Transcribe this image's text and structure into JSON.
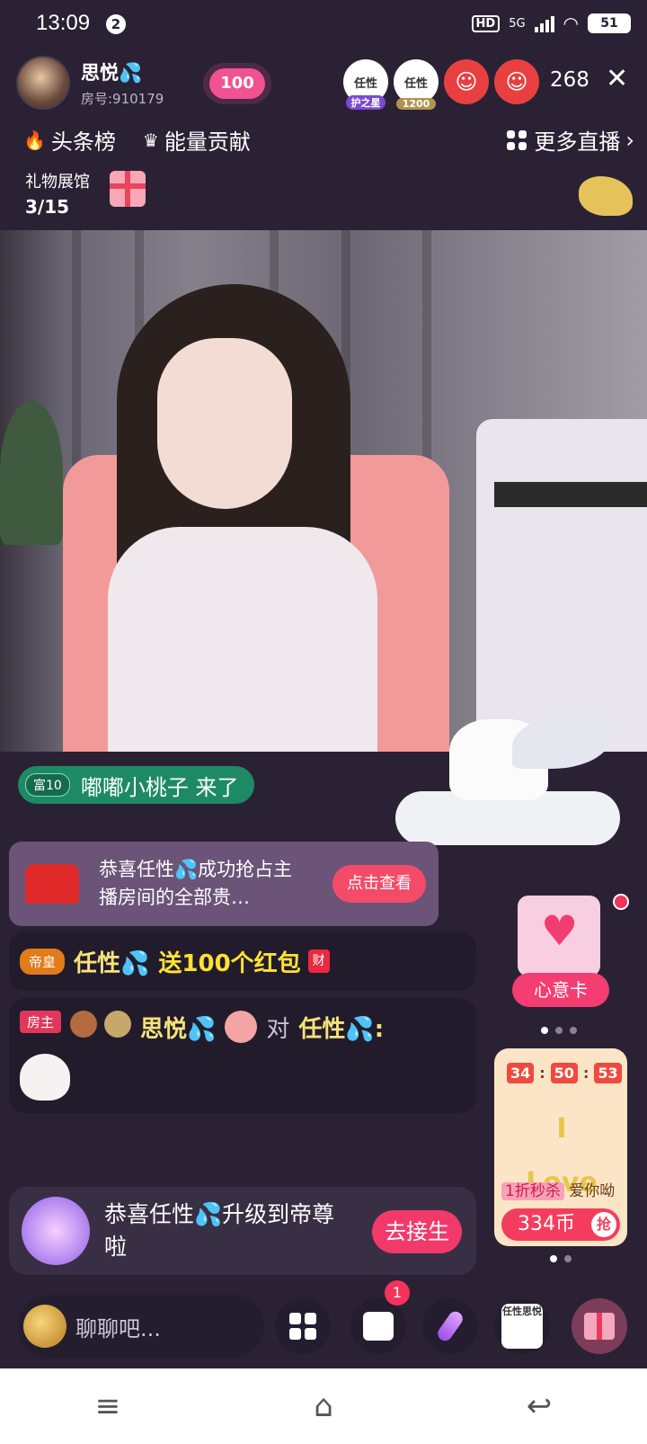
{
  "status_bar": {
    "time": "13:09",
    "notif_count": "2",
    "hd": "HD",
    "network": "5G",
    "battery": "51"
  },
  "header": {
    "host_name": "思悦💦",
    "room_number": "房号:910179",
    "heart_value": "100",
    "viewers": [
      {
        "label": "任性",
        "tag": "护之星"
      },
      {
        "label": "任性",
        "tag": "1200"
      }
    ],
    "viewer_count": "268",
    "tabs": [
      {
        "label": "头条榜",
        "icon": "flame-icon"
      },
      {
        "label": "能量贡献",
        "icon": "crown-icon"
      }
    ],
    "more_live": "更多直播",
    "gift_hall": {
      "title": "礼物展馆",
      "count": "3/15"
    }
  },
  "chat": {
    "enter_badge": "富10",
    "enter_text": "嘟嘟小桃子 来了",
    "card_text": "恭喜任性💦成功抢占主播房间的全部贵…",
    "card_button": "点击查看",
    "redpack_badge": "帝皇",
    "redpack_user": "任性💦",
    "redpack_text": "送100个红包",
    "redpack_icon_text": "财",
    "host_tag": "房主",
    "host_name": "思悦💦",
    "to_word": "对",
    "target": "任性💦:",
    "upgrade_text": "恭喜任性💦升级到帝尊啦",
    "upgrade_button": "去接生"
  },
  "wish_card": {
    "label": "心意卡"
  },
  "promo": {
    "timer": [
      "34",
      "50",
      "53"
    ],
    "love_text": "I Love",
    "sale": "1折秒杀",
    "deal_text": "爱你呦",
    "price": "334币",
    "grab": "抢"
  },
  "bottom": {
    "placeholder": "聊聊吧...",
    "message_badge": "1",
    "avatar_text": "任性思悦"
  },
  "colors": {
    "background": "#2a2234",
    "accent": "#f43d5c",
    "gold": "#f5e27a",
    "green": "#1e8a65"
  }
}
